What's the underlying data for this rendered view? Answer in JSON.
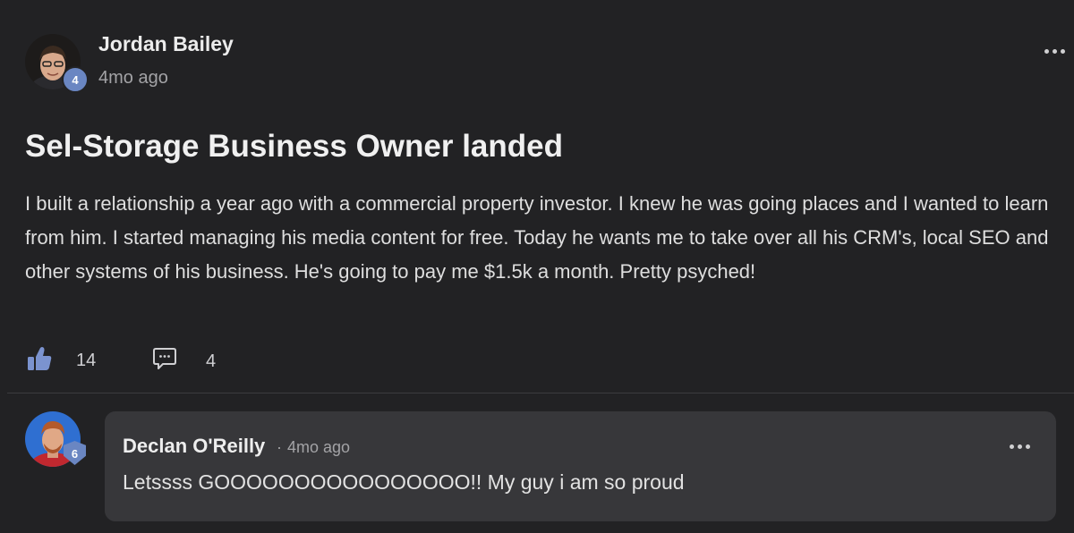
{
  "post": {
    "author": "Jordan Bailey",
    "author_level": "4",
    "time": "4mo ago",
    "title": "Sel-Storage Business Owner landed",
    "body": "I built a relationship a year ago with a commercial property investor. I knew he was going places and I wanted to learn from him. I started managing his media content for free. Today he wants me to take over all his CRM's, local SEO and other systems of his business. He's going to pay me $1.5k a month. Pretty psyched!",
    "likes": "14",
    "comments": "4",
    "like_icon": "thumbs-up-icon",
    "comment_icon": "comment-icon",
    "more_icon": "more-options-icon"
  },
  "comment": {
    "author": "Declan O'Reilly",
    "author_level": "6",
    "separator": "·",
    "time": "4mo ago",
    "text": "Letssss GOOOOOOOOOOOOOOOO!! My guy i am so proud",
    "more_icon": "more-options-icon"
  },
  "colors": {
    "background": "#222224",
    "comment_bubble": "#37373a",
    "level_badge": "#6a86c2",
    "like_icon": "#7b93cf",
    "muted_text": "#a3a3a6"
  }
}
